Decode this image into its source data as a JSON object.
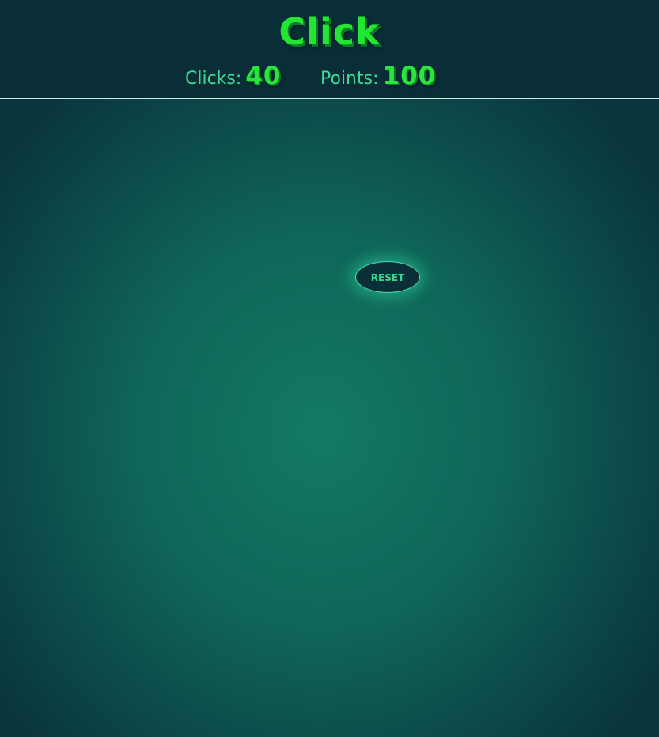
{
  "header": {
    "title": "Click",
    "stats": {
      "clicks_label": "Clicks:",
      "clicks_value": "40",
      "points_label": "Points:",
      "points_value": "100"
    }
  },
  "game": {
    "reset_label": "RESET"
  },
  "colors": {
    "accent": "#22e633",
    "label": "#3ddc93",
    "header_bg": "#0a2e38",
    "field_center": "#137a64",
    "field_edge": "#0a343e"
  }
}
